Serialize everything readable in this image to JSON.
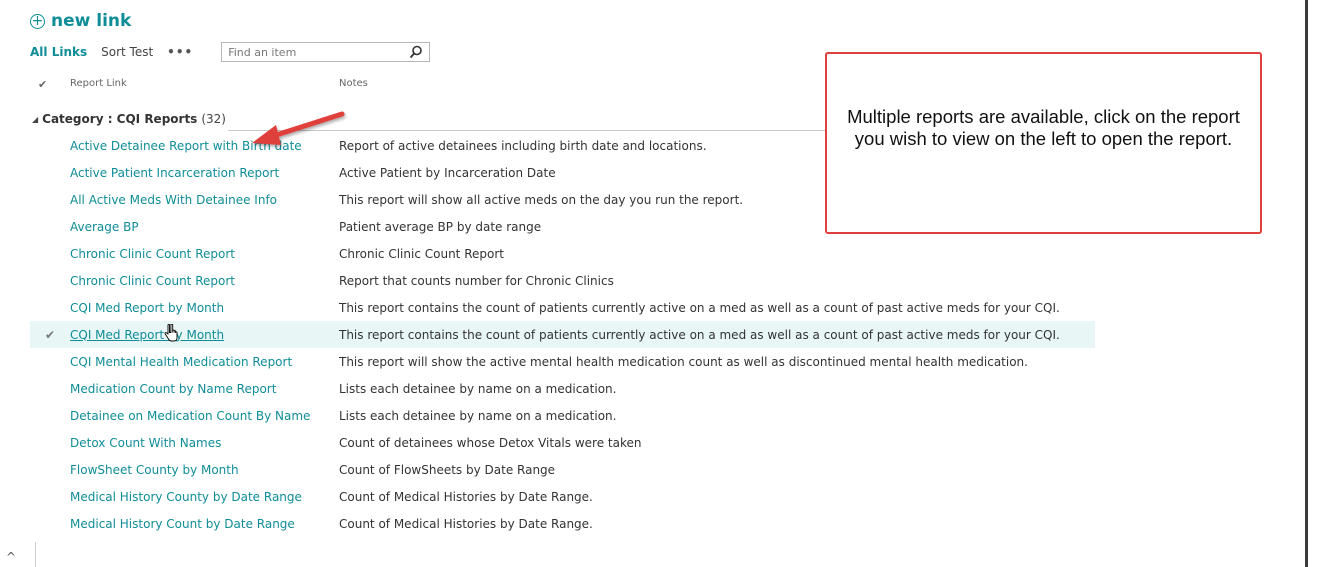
{
  "toolbar": {
    "new_link_label": "new link"
  },
  "views": {
    "items": [
      "All Links",
      "Sort Test"
    ],
    "more": "•••",
    "search_placeholder": "Find an item"
  },
  "columns": {
    "check": "✔",
    "report_link": "Report Link",
    "notes": "Notes"
  },
  "group": {
    "label": "Category : CQI Reports",
    "count": "(32)"
  },
  "rows": [
    {
      "link": "Active Detainee Report with Birth date",
      "note": "Report of active detainees including birth date and locations."
    },
    {
      "link": "Active Patient Incarceration Report",
      "note": "Active Patient by Incarceration Date"
    },
    {
      "link": "All Active Meds With Detainee Info",
      "note": "This report will show all active meds on the day you run the report."
    },
    {
      "link": "Average BP",
      "note": "Patient average BP by date range"
    },
    {
      "link": "Chronic Clinic Count Report",
      "note": "Chronic Clinic Count Report"
    },
    {
      "link": "Chronic Clinic Count Report",
      "note": "Report that counts number for Chronic Clinics"
    },
    {
      "link": "CQI Med Report by Month",
      "note": "This report contains the count of patients currently active on a med as well as a count of past active meds for your CQI."
    },
    {
      "link": "CQI Med Report by Month",
      "note": "This report contains the count of patients currently active on a med as well as a count of past active meds for your CQI.",
      "check": "✔"
    },
    {
      "link": "CQI Mental Health Medication Report",
      "note": "This report will show the active mental health medication count as well as discontinued mental health medication."
    },
    {
      "link": "Medication Count by Name Report",
      "note": "Lists each detainee by name on a medication."
    },
    {
      "link": "Detainee on Medication Count By Name",
      "note": "Lists each detainee by name on a medication."
    },
    {
      "link": "Detox Count With Names",
      "note": "Count of detainees whose Detox Vitals were taken"
    },
    {
      "link": "FlowSheet County by Month",
      "note": "Count of FlowSheets by Date Range"
    },
    {
      "link": "Medical History County by Date Range",
      "note": "Count of Medical Histories by Date Range."
    },
    {
      "link": "Medical History Count by Date Range",
      "note": "Count of Medical Histories by Date Range."
    }
  ],
  "callout": {
    "text": "Multiple reports are available, click on the report you wish to view on the left to open the report."
  },
  "colors": {
    "accent": "#0f8d97",
    "annotation": "#e0403b",
    "selected_row": "#e8f6f6"
  },
  "icons": {
    "new_link": "plus-circle-icon",
    "search": "search-icon",
    "group_toggle": "triangle-down-icon",
    "cursor": "hand-pointer-icon",
    "scroll": "chevron-up-icon"
  }
}
